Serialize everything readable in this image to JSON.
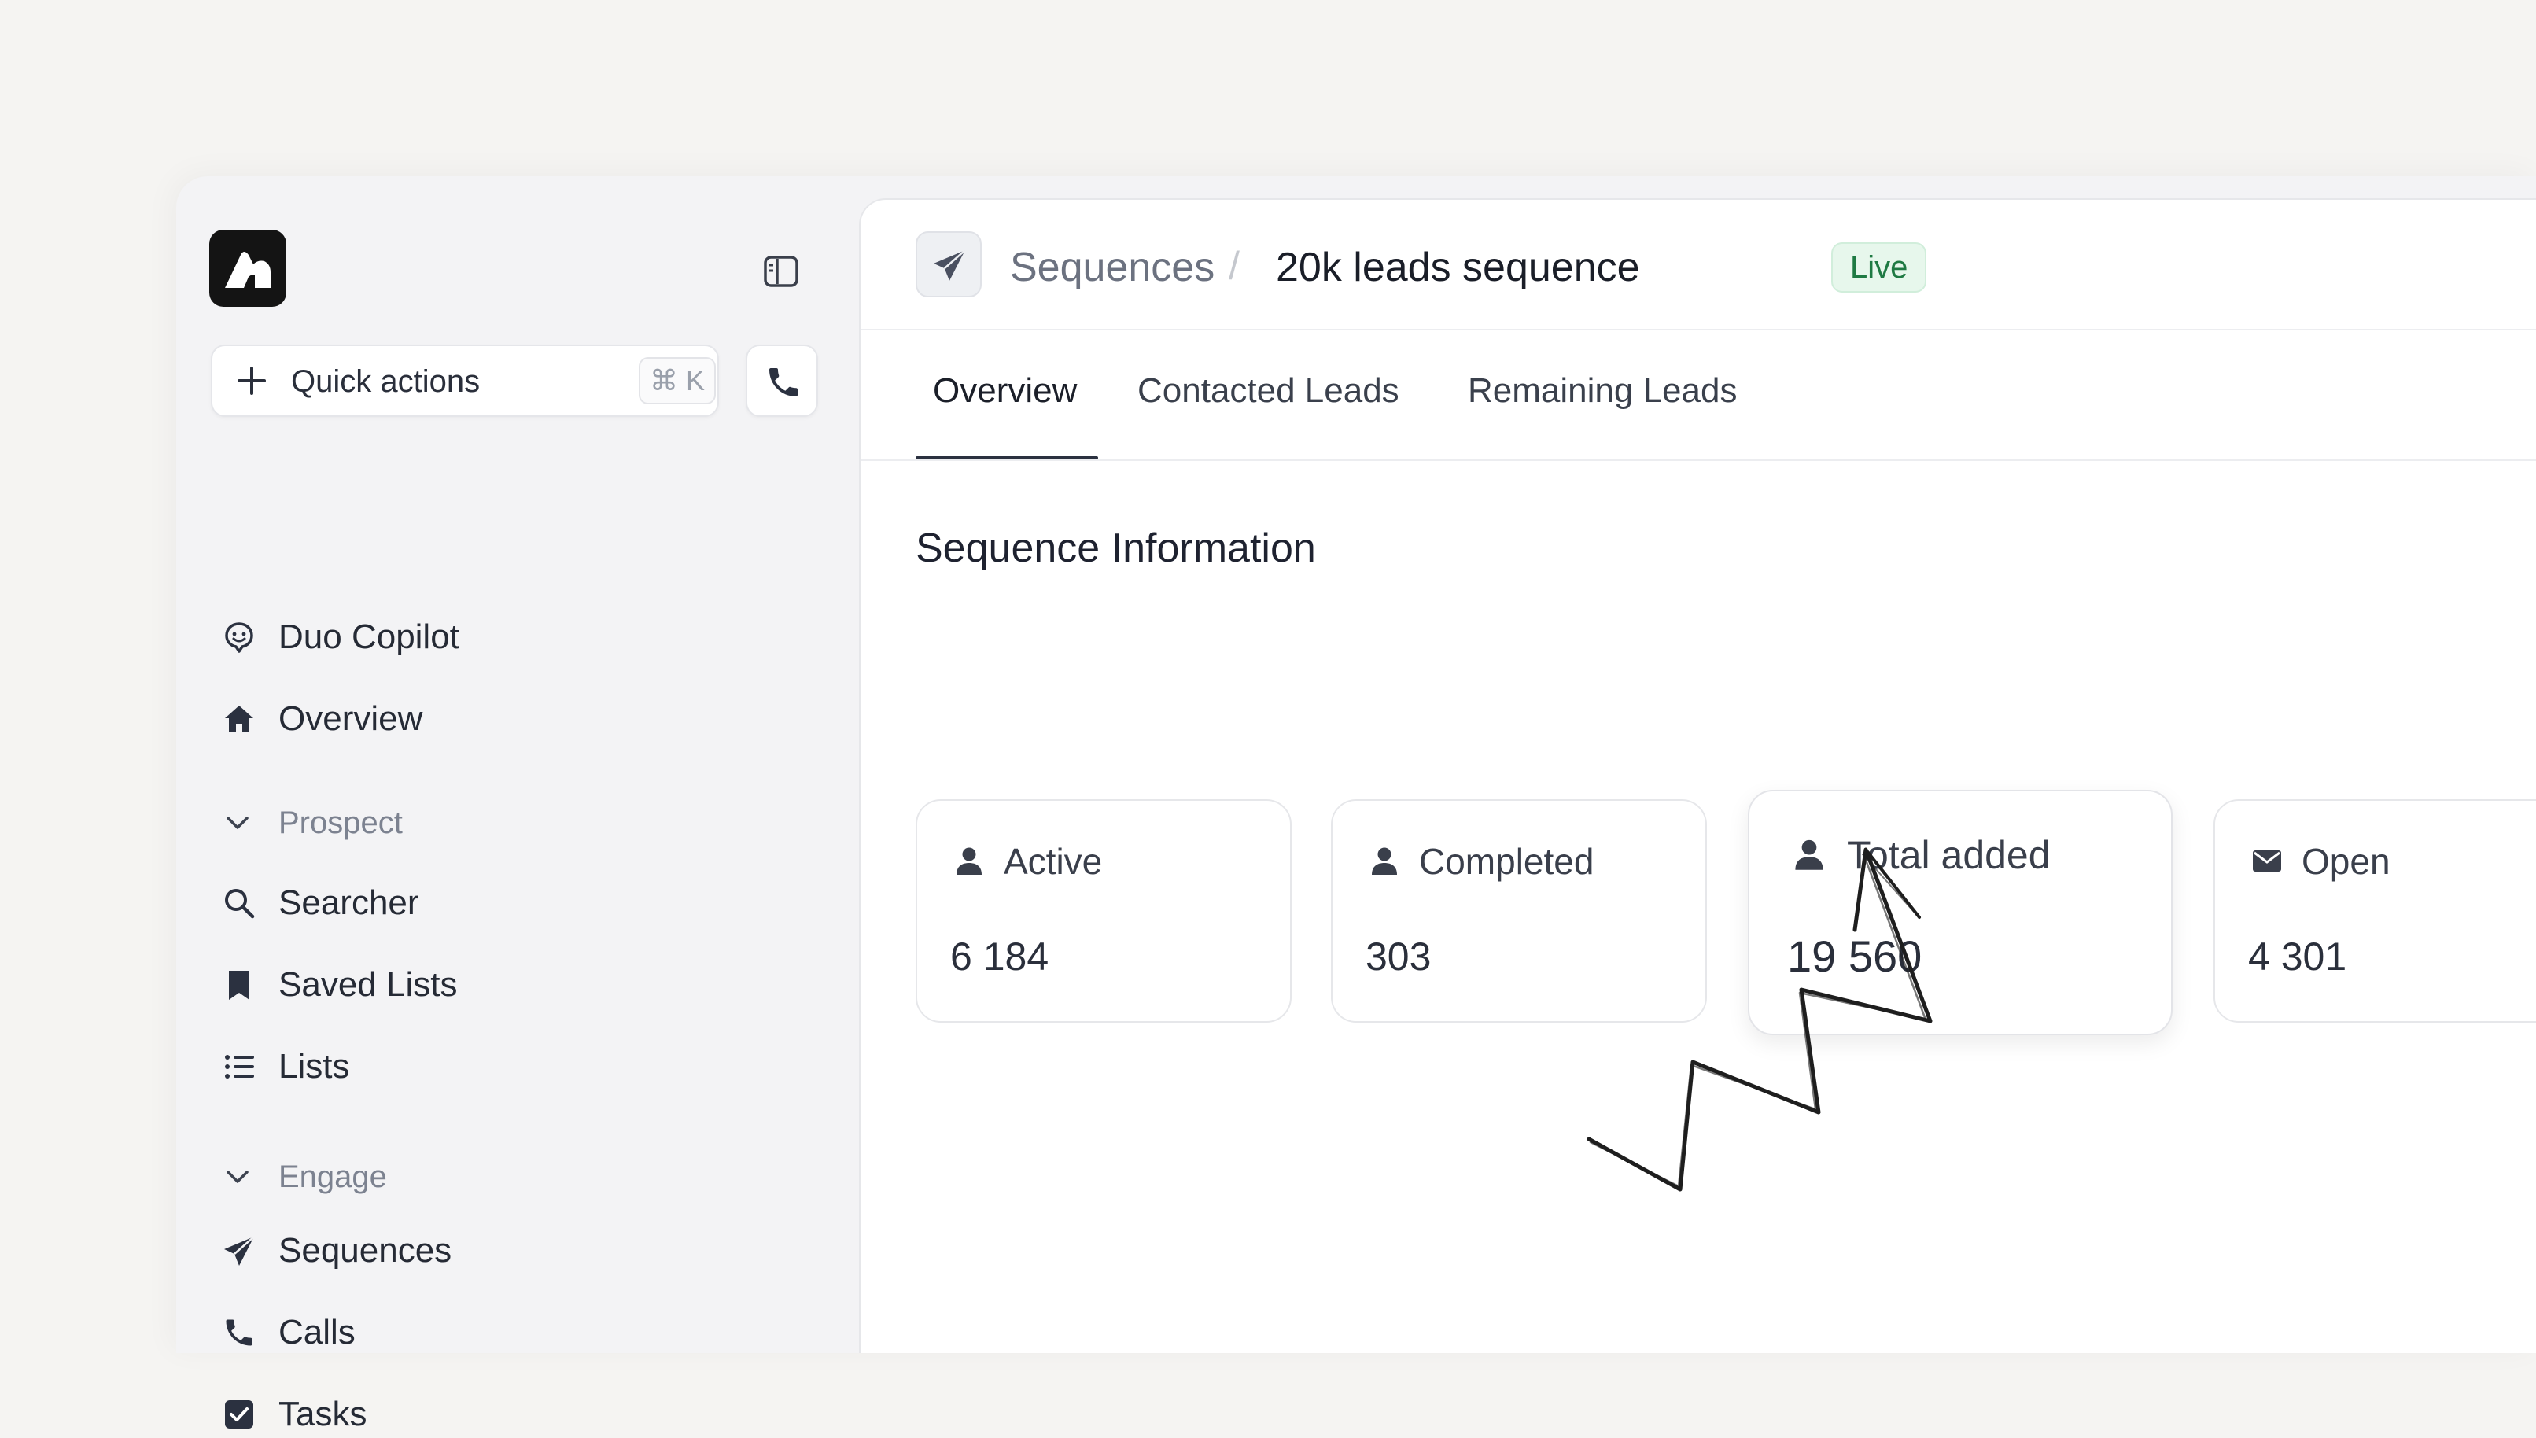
{
  "sidebar": {
    "quick_actions": {
      "label": "Quick actions",
      "shortcut": "⌘ K"
    },
    "items": [
      {
        "label": "Duo Copilot",
        "icon": "copilot-icon"
      },
      {
        "label": "Overview",
        "icon": "home-icon"
      }
    ],
    "sections": [
      {
        "title": "Prospect",
        "items": [
          {
            "label": "Searcher",
            "icon": "search-icon"
          },
          {
            "label": "Saved Lists",
            "icon": "bookmark-icon"
          },
          {
            "label": "Lists",
            "icon": "list-icon"
          }
        ]
      },
      {
        "title": "Engage",
        "items": [
          {
            "label": "Sequences",
            "icon": "paper-plane-icon"
          },
          {
            "label": "Calls",
            "icon": "phone-icon"
          },
          {
            "label": "Tasks",
            "icon": "checkbox-icon"
          }
        ]
      }
    ]
  },
  "breadcrumb": {
    "parent": "Sequences",
    "separator": "/",
    "current": "20k leads sequence",
    "status": "Live"
  },
  "tabs": [
    {
      "label": "Overview",
      "active": true
    },
    {
      "label": "Contacted Leads",
      "active": false
    },
    {
      "label": "Remaining Leads",
      "active": false
    }
  ],
  "section_title": "Sequence Information",
  "stats": [
    {
      "label": "Active",
      "value": "6 184",
      "icon": "user-icon"
    },
    {
      "label": "Completed",
      "value": "303",
      "icon": "user-icon"
    },
    {
      "label": "Total added",
      "value": "19 560",
      "icon": "user-icon"
    },
    {
      "label": "Open",
      "value": "4 301",
      "icon": "envelope-icon"
    }
  ],
  "colors": {
    "live_badge_bg": "#e7f7ec",
    "live_badge_text": "#1f7a43",
    "text_primary": "#1f2430",
    "logo_bg": "#141414"
  }
}
